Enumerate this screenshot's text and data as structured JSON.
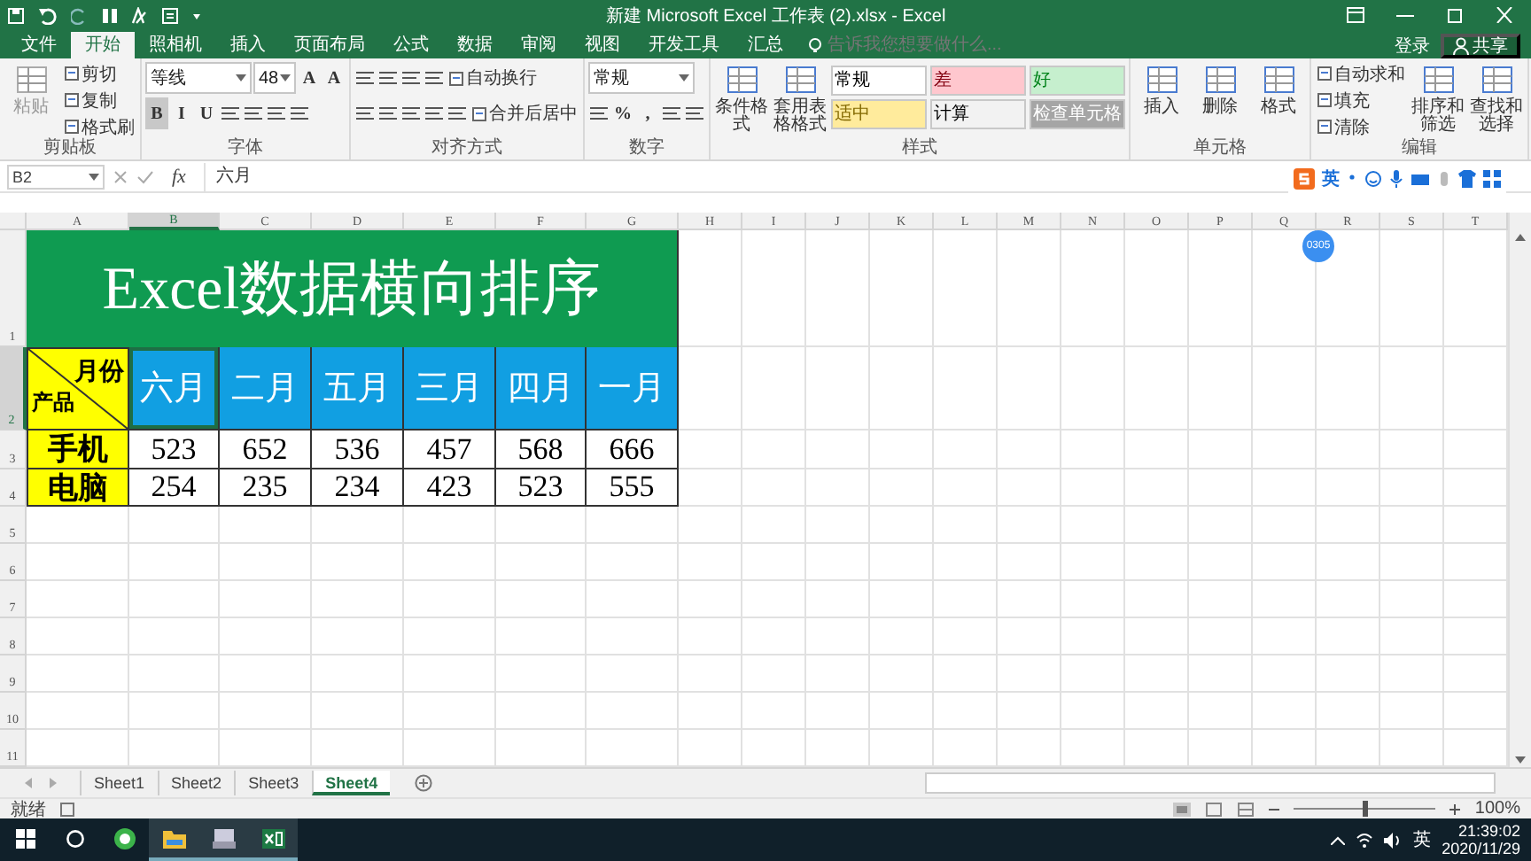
{
  "title_bar": {
    "title": "新建 Microsoft Excel 工作表 (2).xlsx - Excel"
  },
  "ribbon_tabs": [
    {
      "label": "文件",
      "selected": false
    },
    {
      "label": "开始",
      "selected": true
    },
    {
      "label": "照相机",
      "selected": false
    },
    {
      "label": "插入",
      "selected": false
    },
    {
      "label": "页面布局",
      "selected": false
    },
    {
      "label": "公式",
      "selected": false
    },
    {
      "label": "数据",
      "selected": false
    },
    {
      "label": "审阅",
      "selected": false
    },
    {
      "label": "视图",
      "selected": false
    },
    {
      "label": "开发工具",
      "selected": false
    },
    {
      "label": "汇总",
      "selected": false
    }
  ],
  "tell_me": {
    "placeholder": "告诉我您想要做什么..."
  },
  "account": {
    "sign_in": "登录",
    "share": "共享"
  },
  "ribbon_groups": [
    {
      "label": "剪贴板",
      "sections": [
        {
          "kind": "large",
          "label": "粘贴",
          "disabled": true
        },
        {
          "kind": "stack",
          "rows": [
            {
              "items": [
                {
                  "kind": "small",
                  "label": "剪切"
                }
              ]
            },
            {
              "items": [
                {
                  "kind": "small",
                  "label": "复制"
                }
              ]
            },
            {
              "items": [
                {
                  "kind": "small",
                  "label": "格式刷"
                }
              ]
            }
          ]
        }
      ]
    },
    {
      "label": "字体",
      "sections": [
        {
          "kind": "stack",
          "rows": [
            {
              "items": [
                {
                  "kind": "dropdown",
                  "value": "等线"
                },
                {
                  "kind": "spin",
                  "value": "48"
                },
                {
                  "kind": "toggle",
                  "label": "A",
                  "on": false
                },
                {
                  "kind": "toggle",
                  "label": "A",
                  "on": false
                }
              ]
            },
            {
              "items": [
                {
                  "kind": "toggle",
                  "label": "B",
                  "on": true
                },
                {
                  "kind": "toggle",
                  "label": "I",
                  "on": false
                },
                {
                  "kind": "toggle",
                  "label": "U",
                  "on": false
                },
                {
                  "kind": "icon"
                },
                {
                  "kind": "icon"
                },
                {
                  "kind": "icon"
                },
                {
                  "kind": "icon"
                }
              ]
            }
          ]
        }
      ]
    },
    {
      "label": "对齐方式",
      "sections": [
        {
          "kind": "stack",
          "rows": [
            {
              "items": [
                {
                  "kind": "icon"
                },
                {
                  "kind": "icon"
                },
                {
                  "kind": "icon"
                },
                {
                  "kind": "icon"
                },
                {
                  "kind": "small",
                  "label": "自动换行"
                }
              ]
            },
            {
              "items": [
                {
                  "kind": "icon"
                },
                {
                  "kind": "icon"
                },
                {
                  "kind": "icon"
                },
                {
                  "kind": "icon"
                },
                {
                  "kind": "icon"
                },
                {
                  "kind": "small",
                  "label": "合并后居中"
                }
              ]
            }
          ]
        }
      ]
    },
    {
      "label": "数字",
      "sections": [
        {
          "kind": "stack",
          "rows": [
            {
              "items": [
                {
                  "kind": "dropdown",
                  "value": "常规"
                }
              ]
            },
            {
              "items": [
                {
                  "kind": "icon"
                },
                {
                  "kind": "toggle",
                  "label": "%",
                  "on": false
                },
                {
                  "kind": "toggle",
                  "label": ",",
                  "on": false
                },
                {
                  "kind": "icon"
                },
                {
                  "kind": "icon"
                }
              ]
            }
          ]
        }
      ]
    },
    {
      "label": "样式",
      "sections": [
        {
          "kind": "large",
          "label": "条件格式",
          "disabled": false
        },
        {
          "kind": "large",
          "label": "套用表格格式",
          "disabled": false
        },
        {
          "kind": "styles",
          "cells": [
            {
              "label": "常规",
              "color": "#ffffff"
            },
            {
              "label": "差",
              "color": "#ffc7ce"
            },
            {
              "label": "好",
              "color": "#c6efce"
            },
            {
              "label": "适中",
              "color": "#ffeb9c"
            },
            {
              "label": "计算",
              "color": "#f2f2f2"
            },
            {
              "label": "检查单元格",
              "color": "#a5a5a5"
            }
          ]
        }
      ]
    },
    {
      "label": "单元格",
      "sections": [
        {
          "kind": "large",
          "label": "插入",
          "disabled": false
        },
        {
          "kind": "large",
          "label": "删除",
          "disabled": false
        },
        {
          "kind": "large",
          "label": "格式",
          "disabled": false
        }
      ]
    },
    {
      "label": "编辑",
      "sections": [
        {
          "kind": "stack",
          "rows": [
            {
              "items": [
                {
                  "kind": "small",
                  "label": "自动求和"
                }
              ]
            },
            {
              "items": [
                {
                  "kind": "small",
                  "label": "填充"
                }
              ]
            },
            {
              "items": [
                {
                  "kind": "small",
                  "label": "清除"
                }
              ]
            }
          ]
        },
        {
          "kind": "large",
          "label": "排序和筛选",
          "disabled": false
        },
        {
          "kind": "large",
          "label": "查找和选择",
          "disabled": false
        }
      ]
    }
  ],
  "formula_bar": {
    "name_box": "B2",
    "function_label": "fx",
    "formula": "六月"
  },
  "ime_toolbar": {
    "mode": "英"
  },
  "overlay_badge": {
    "text": "0305"
  },
  "sheet": {
    "columns": [
      {
        "label": "A",
        "selected": false
      },
      {
        "label": "B",
        "selected": true
      },
      {
        "label": "C",
        "selected": false
      },
      {
        "label": "D",
        "selected": false
      },
      {
        "label": "E",
        "selected": false
      },
      {
        "label": "F",
        "selected": false
      },
      {
        "label": "G",
        "selected": false
      },
      {
        "label": "H",
        "selected": false
      },
      {
        "label": "I",
        "selected": false
      },
      {
        "label": "J",
        "selected": false
      },
      {
        "label": "K",
        "selected": false
      },
      {
        "label": "L",
        "selected": false
      },
      {
        "label": "M",
        "selected": false
      },
      {
        "label": "N",
        "selected": false
      },
      {
        "label": "O",
        "selected": false
      },
      {
        "label": "P",
        "selected": false
      },
      {
        "label": "Q",
        "selected": false
      },
      {
        "label": "R",
        "selected": false
      },
      {
        "label": "S",
        "selected": false
      },
      {
        "label": "T",
        "selected": false
      }
    ],
    "row_numbers": [
      {
        "label": "1",
        "selected": false
      },
      {
        "label": "2",
        "selected": true
      },
      {
        "label": "3",
        "selected": false
      },
      {
        "label": "4",
        "selected": false
      },
      {
        "label": "5",
        "selected": false
      },
      {
        "label": "6",
        "selected": false
      },
      {
        "label": "7",
        "selected": false
      },
      {
        "label": "8",
        "selected": false
      },
      {
        "label": "9",
        "selected": false
      },
      {
        "label": "10",
        "selected": false
      },
      {
        "label": "11",
        "selected": false
      }
    ],
    "title": "Excel数据横向排序",
    "corner": {
      "top": "月份",
      "bottom": "产品"
    },
    "months": [
      {
        "label": "六月",
        "selected": true
      },
      {
        "label": "二月",
        "selected": false
      },
      {
        "label": "五月",
        "selected": false
      },
      {
        "label": "三月",
        "selected": false
      },
      {
        "label": "四月",
        "selected": false
      },
      {
        "label": "一月",
        "selected": false
      }
    ],
    "products": [
      {
        "name": "手机",
        "values": [
          "523",
          "652",
          "536",
          "457",
          "568",
          "666"
        ]
      },
      {
        "name": "电脑",
        "values": [
          "254",
          "235",
          "234",
          "423",
          "523",
          "555"
        ]
      }
    ]
  },
  "sheet_tabs": [
    {
      "label": "Sheet1",
      "selected": false
    },
    {
      "label": "Sheet2",
      "selected": false
    },
    {
      "label": "Sheet3",
      "selected": false
    },
    {
      "label": "Sheet4",
      "selected": true
    }
  ],
  "status_bar": {
    "status": "就绪",
    "zoom": "100%",
    "zoom_slider": {
      "level": 0.5
    }
  },
  "taskbar": {
    "ime": "英",
    "time": "21:39:02",
    "date": "2020/11/29"
  }
}
